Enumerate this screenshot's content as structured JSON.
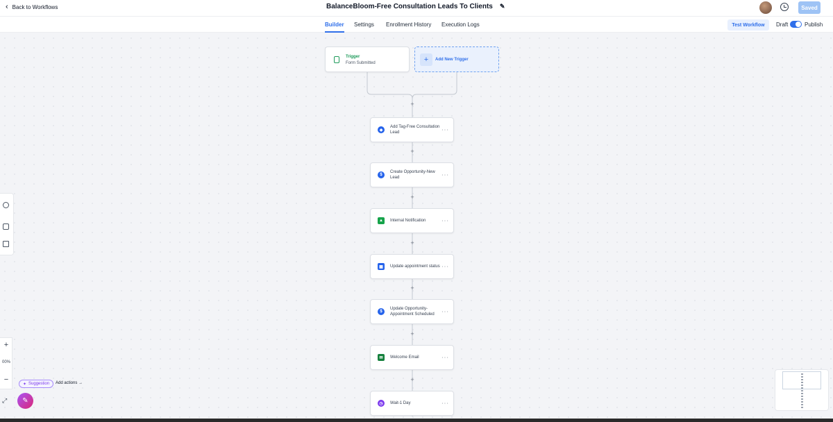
{
  "header": {
    "back_label": "Back to Workflows",
    "workflow_title": "BalanceBloom-Free Consultation Leads To Clients",
    "saved_label": "Saved"
  },
  "tabs": [
    {
      "label": "Builder",
      "active": true
    },
    {
      "label": "Settings",
      "active": false
    },
    {
      "label": "Enrollment History",
      "active": false
    },
    {
      "label": "Execution Logs",
      "active": false
    }
  ],
  "actions": {
    "test_workflow": "Test Workflow",
    "draft": "Draft",
    "publish": "Publish",
    "publish_on": true
  },
  "trigger": {
    "title": "Trigger",
    "subtitle": "Form Submitted",
    "add_new": "Add New Trigger"
  },
  "steps": [
    {
      "label": "Add Tag-Free Consultation Lead",
      "icon": "tag-icon",
      "color": "#2563eb"
    },
    {
      "label": "Create Opportunity-New Lead",
      "icon": "dollar-icon",
      "color": "#2563eb"
    },
    {
      "label": "Internal Notification",
      "icon": "bell-icon",
      "color": "#16a34a"
    },
    {
      "label": "Update appointment status",
      "icon": "calendar-icon",
      "color": "#2563eb"
    },
    {
      "label": "Update Opportunity-Appointment Scheduled",
      "icon": "dollar-icon",
      "color": "#2563eb"
    },
    {
      "label": "Welcome Email",
      "icon": "email-icon",
      "color": "#15803d"
    },
    {
      "label": "Wait-1 Day",
      "icon": "clock-icon",
      "color": "#7c3aed"
    }
  ],
  "zoom": {
    "level": "00%"
  },
  "suggestion": {
    "label": "Suggestion",
    "add_actions": "Add actions"
  }
}
